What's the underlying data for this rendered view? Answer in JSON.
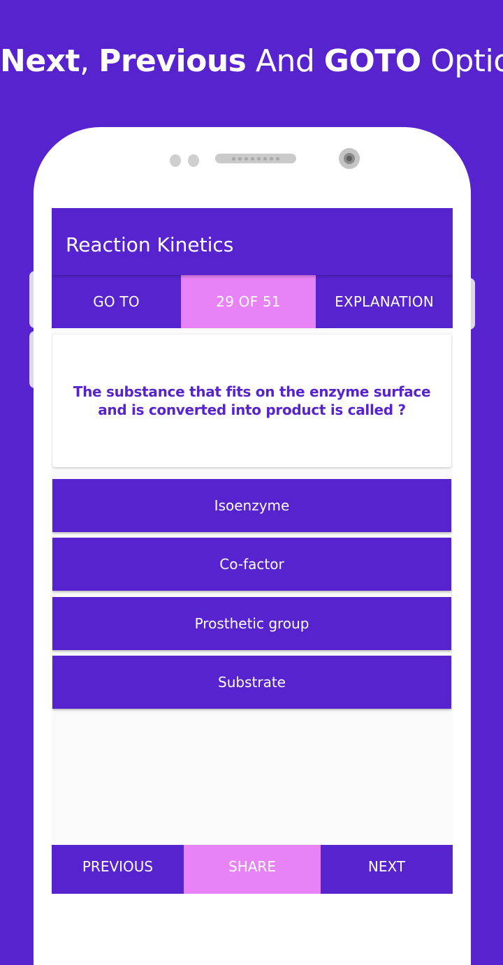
{
  "promo": {
    "headline_parts": [
      {
        "text": "Next",
        "weight": "bold"
      },
      {
        "text": ", ",
        "weight": "light"
      },
      {
        "text": "Previous",
        "weight": "bold"
      },
      {
        "text": " And ",
        "weight": "light"
      },
      {
        "text": "GOTO",
        "weight": "bold"
      },
      {
        "text": " Options",
        "weight": "light"
      }
    ]
  },
  "app": {
    "title": "Reaction Kinetics",
    "top_bar": {
      "goto_label": "GO TO",
      "progress_label": "29 OF 51",
      "explanation_label": "EXPLANATION"
    },
    "question": "The substance that fits on the enzyme surface and is converted into product is called ?",
    "options": [
      "Isoenzyme",
      "Co-factor",
      "Prosthetic group",
      "Substrate"
    ],
    "bottom_bar": {
      "previous_label": "PREVIOUS",
      "share_label": "SHARE",
      "next_label": "NEXT"
    }
  },
  "colors": {
    "primary": "#5723cf",
    "accent": "#e882f7",
    "background": "#fafafa"
  },
  "icons": {
    "front_sensors": "sensor-dots",
    "speaker": "speaker-grille",
    "camera": "front-camera"
  }
}
